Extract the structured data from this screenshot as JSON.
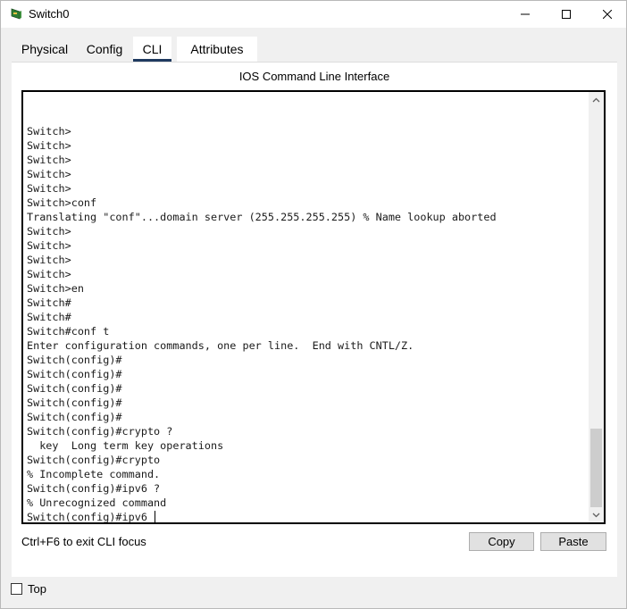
{
  "window": {
    "title": "Switch0",
    "icons": {
      "app": "switch-device-icon",
      "minimize": "minimize-icon",
      "maximize": "maximize-icon",
      "close": "close-icon"
    }
  },
  "tabs": [
    {
      "label": "Physical"
    },
    {
      "label": "Config"
    },
    {
      "label": "CLI",
      "selected": true
    },
    {
      "label": "Attributes"
    }
  ],
  "cli": {
    "panel_title": "IOS Command Line Interface",
    "lines": [
      "Switch>",
      "Switch>",
      "Switch>",
      "Switch>",
      "Switch>",
      "Switch>conf",
      "Translating \"conf\"...domain server (255.255.255.255) % Name lookup aborted",
      "Switch>",
      "Switch>",
      "Switch>",
      "Switch>",
      "Switch>en",
      "Switch#",
      "Switch#",
      "Switch#conf t",
      "Enter configuration commands, one per line.  End with CNTL/Z.",
      "Switch(config)#",
      "Switch(config)#",
      "Switch(config)#",
      "Switch(config)#",
      "Switch(config)#",
      "Switch(config)#crypto ?",
      "  key  Long term key operations",
      "Switch(config)#crypto",
      "% Incomplete command.",
      "Switch(config)#ipv6 ?",
      "% Unrecognized command",
      "Switch(config)#ipv6 "
    ],
    "hint": "Ctrl+F6 to exit CLI focus",
    "copy_label": "Copy",
    "paste_label": "Paste"
  },
  "footer": {
    "top_label": "Top",
    "top_checked": false
  }
}
